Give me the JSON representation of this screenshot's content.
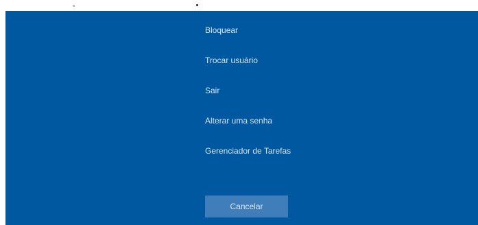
{
  "security_screen": {
    "options": [
      {
        "id": "lock",
        "label": "Bloquear"
      },
      {
        "id": "switch-user",
        "label": "Trocar usuário"
      },
      {
        "id": "sign-out",
        "label": "Sair"
      },
      {
        "id": "change-password",
        "label": "Alterar uma senha"
      },
      {
        "id": "task-manager",
        "label": "Gerenciador de Tarefas"
      }
    ],
    "cancel_label": "Cancelar"
  },
  "colors": {
    "background": "#0058a0",
    "text": "#d6e4f2",
    "button": "#3f7dbb"
  }
}
